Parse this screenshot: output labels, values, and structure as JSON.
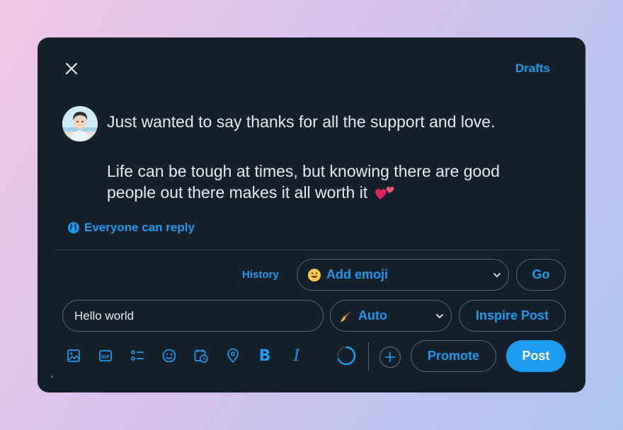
{
  "header": {
    "drafts_label": "Drafts"
  },
  "tweet": {
    "line1": "Just wanted to say thanks for all the support and love.",
    "line2a": "Life can be tough at times, but knowing there are good",
    "line2b": "people out there makes it all worth it",
    "emoji_icon": "two-hearts-icon"
  },
  "reply_setting": {
    "label": "Everyone can reply",
    "icon": "globe-icon"
  },
  "controls": {
    "history_label": "History",
    "emoji_select_label": "Add emoji",
    "go_label": "Go",
    "text_input_value": "Hello world",
    "tone_select_label": "Auto",
    "inspire_label": "Inspire Post"
  },
  "toolbar": {
    "icons": [
      "image-icon",
      "gif-icon",
      "poll-icon",
      "emoji-icon",
      "schedule-icon",
      "location-icon",
      "bold-icon",
      "italic-icon"
    ],
    "bold_glyph": "B",
    "italic_glyph": "I",
    "promote_label": "Promote",
    "post_label": "Post"
  },
  "colors": {
    "accent": "#1d9bf0",
    "background": "#15202b",
    "text": "#e7e9ea",
    "border": "#536471"
  }
}
